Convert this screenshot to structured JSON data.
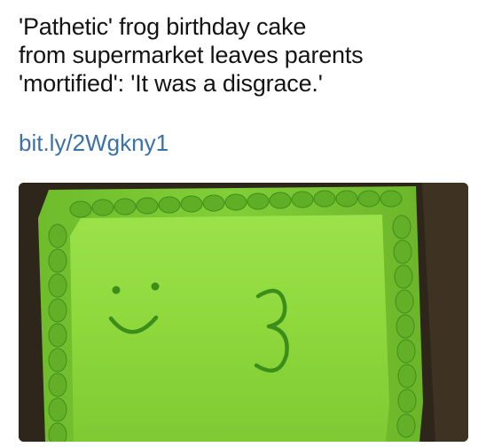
{
  "post": {
    "headline_lines": [
      "'Pathetic' frog birthday cake",
      "from supermarket leaves parents",
      "'mortified': 'It was a disgrace.'"
    ],
    "link": "bit.ly/2Wgkny1"
  },
  "photo": {
    "subject": "green frosted sheet cake with smiley face and number",
    "cake_number": "3",
    "colors": {
      "frosting": "#8ed83c",
      "piping": "#3f8f1c",
      "background": "#2f261b"
    }
  }
}
